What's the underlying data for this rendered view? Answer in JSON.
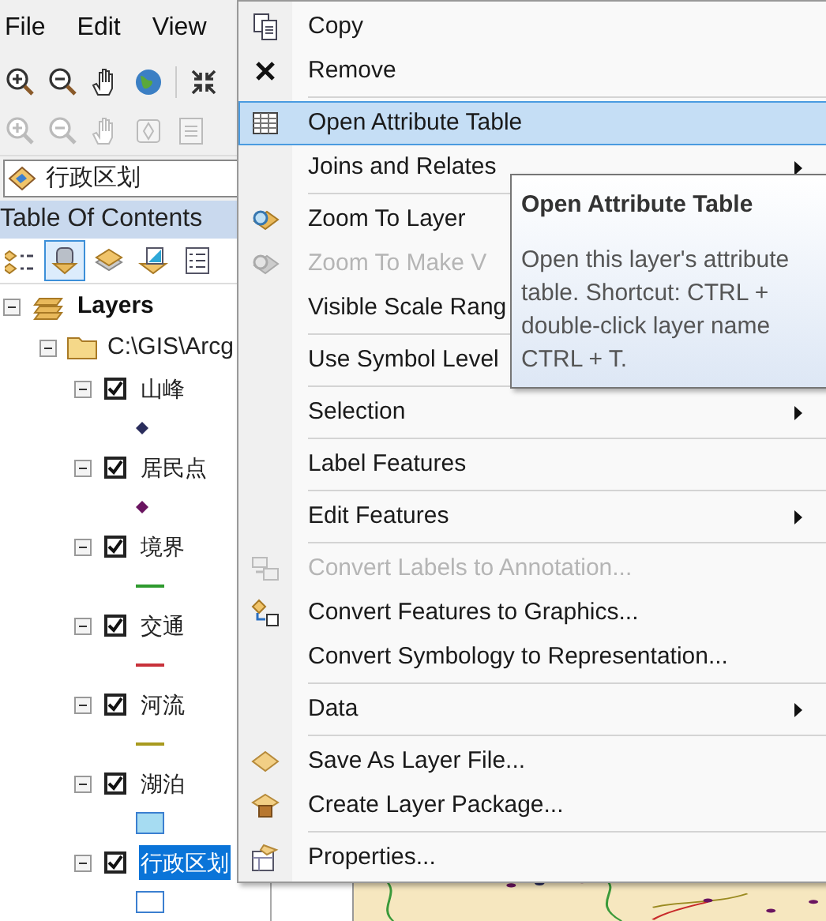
{
  "menubar": [
    {
      "label": "File"
    },
    {
      "label": "Edit"
    },
    {
      "label": "View"
    }
  ],
  "layer_selector": {
    "value": "行政区划"
  },
  "toc": {
    "title": "Table Of Contents",
    "tools": [
      {
        "kind": "drawing",
        "selected": false
      },
      {
        "kind": "source",
        "selected": true
      },
      {
        "kind": "visibility",
        "selected": false
      },
      {
        "kind": "selection",
        "selected": false
      },
      {
        "kind": "options",
        "selected": false
      }
    ]
  },
  "tree": {
    "label": "Layers",
    "expanded": true,
    "children": [
      {
        "label": "C:\\GIS\\Arcg",
        "expanded": true,
        "children": [
          {
            "label": "山峰",
            "checked": true,
            "selected": false,
            "expanded": true,
            "kind": "point",
            "color": "#2a2d5c"
          },
          {
            "label": "居民点",
            "checked": true,
            "selected": false,
            "expanded": true,
            "kind": "point",
            "color": "#6a1460"
          },
          {
            "label": "境界",
            "checked": true,
            "selected": false,
            "expanded": true,
            "kind": "line",
            "color": "#2e9a2e"
          },
          {
            "label": "交通",
            "checked": true,
            "selected": false,
            "expanded": true,
            "kind": "line",
            "color": "#c8313a"
          },
          {
            "label": "河流",
            "checked": true,
            "selected": false,
            "expanded": true,
            "kind": "line",
            "color": "#a89a1e"
          },
          {
            "label": "湖泊",
            "checked": true,
            "selected": false,
            "expanded": true,
            "kind": "fill",
            "color": "#a6dcf2"
          },
          {
            "label": "行政区划",
            "checked": true,
            "selected": true,
            "expanded": true,
            "kind": "fill",
            "color": "#ffffff"
          }
        ]
      }
    ]
  },
  "context_menu": {
    "items": [
      {
        "label": "Copy",
        "kind": "copy",
        "disabled": false,
        "selected": false,
        "submenu": false,
        "separator_after": false
      },
      {
        "label": "Remove",
        "kind": "remove",
        "disabled": false,
        "selected": false,
        "submenu": false,
        "separator_after": true
      },
      {
        "label": "Open Attribute Table",
        "kind": "table",
        "disabled": false,
        "selected": true,
        "submenu": false,
        "separator_after": false
      },
      {
        "label": "Joins and Relates",
        "disabled": false,
        "selected": false,
        "submenu": true,
        "separator_after": true
      },
      {
        "label": "Zoom To Layer",
        "kind": "zoom-layer",
        "disabled": false,
        "selected": false,
        "submenu": false,
        "separator_after": false
      },
      {
        "label": "Zoom To Make V",
        "kind": "zoom-visible",
        "disabled": true,
        "selected": false,
        "submenu": false,
        "separator_after": false
      },
      {
        "label": "Visible Scale Rang",
        "disabled": false,
        "selected": false,
        "submenu": false,
        "separator_after": true
      },
      {
        "label": "Use Symbol Level",
        "disabled": false,
        "selected": false,
        "submenu": false,
        "separator_after": true
      },
      {
        "label": "Selection",
        "disabled": false,
        "selected": false,
        "submenu": true,
        "separator_after": true
      },
      {
        "label": "Label Features",
        "disabled": false,
        "selected": false,
        "submenu": false,
        "separator_after": true
      },
      {
        "label": "Edit Features",
        "disabled": false,
        "selected": false,
        "submenu": true,
        "separator_after": true
      },
      {
        "label": "Convert Labels to Annotation...",
        "kind": "convert-labels",
        "disabled": true,
        "selected": false,
        "submenu": false,
        "separator_after": false
      },
      {
        "label": "Convert Features to Graphics...",
        "kind": "convert-features",
        "disabled": false,
        "selected": false,
        "submenu": false,
        "separator_after": false
      },
      {
        "label": "Convert Symbology to Representation...",
        "disabled": false,
        "selected": false,
        "submenu": false,
        "separator_after": true
      },
      {
        "label": "Data",
        "disabled": false,
        "selected": false,
        "submenu": true,
        "separator_after": true
      },
      {
        "label": "Save As Layer File...",
        "kind": "save-layer",
        "disabled": false,
        "selected": false,
        "submenu": false,
        "separator_after": false
      },
      {
        "label": "Create Layer Package...",
        "kind": "create-package",
        "disabled": false,
        "selected": false,
        "submenu": false,
        "separator_after": true
      },
      {
        "label": "Properties...",
        "kind": "properties",
        "disabled": false,
        "selected": false,
        "submenu": false,
        "separator_after": false
      }
    ]
  },
  "tooltip": {
    "title": "Open Attribute Table",
    "lines": [
      "Open this layer's attribute",
      "table. Shortcut: CTRL +",
      "double-click layer name",
      "CTRL + T."
    ]
  }
}
